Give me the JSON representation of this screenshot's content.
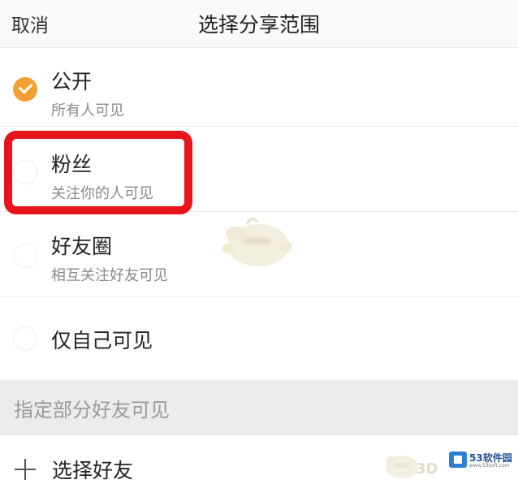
{
  "header": {
    "cancel_label": "取消",
    "title": "选择分享范围"
  },
  "options": [
    {
      "label": "公开",
      "sub": "所有人可见",
      "selected": true
    },
    {
      "label": "粉丝",
      "sub": "关注你的人可见",
      "selected": false
    },
    {
      "label": "好友圈",
      "sub": "相互关注好友可见",
      "selected": false
    },
    {
      "label": "仅自己可见",
      "selected": false
    }
  ],
  "section": {
    "title": "指定部分好友可见"
  },
  "select_friends": {
    "label": "选择好友",
    "icon": "plus-icon"
  },
  "watermark": {
    "text": "3D",
    "site_name": "53软件园",
    "site_url": "www.53soft.com"
  },
  "colors": {
    "accent": "#f2a033",
    "highlight": "#e8141d"
  }
}
